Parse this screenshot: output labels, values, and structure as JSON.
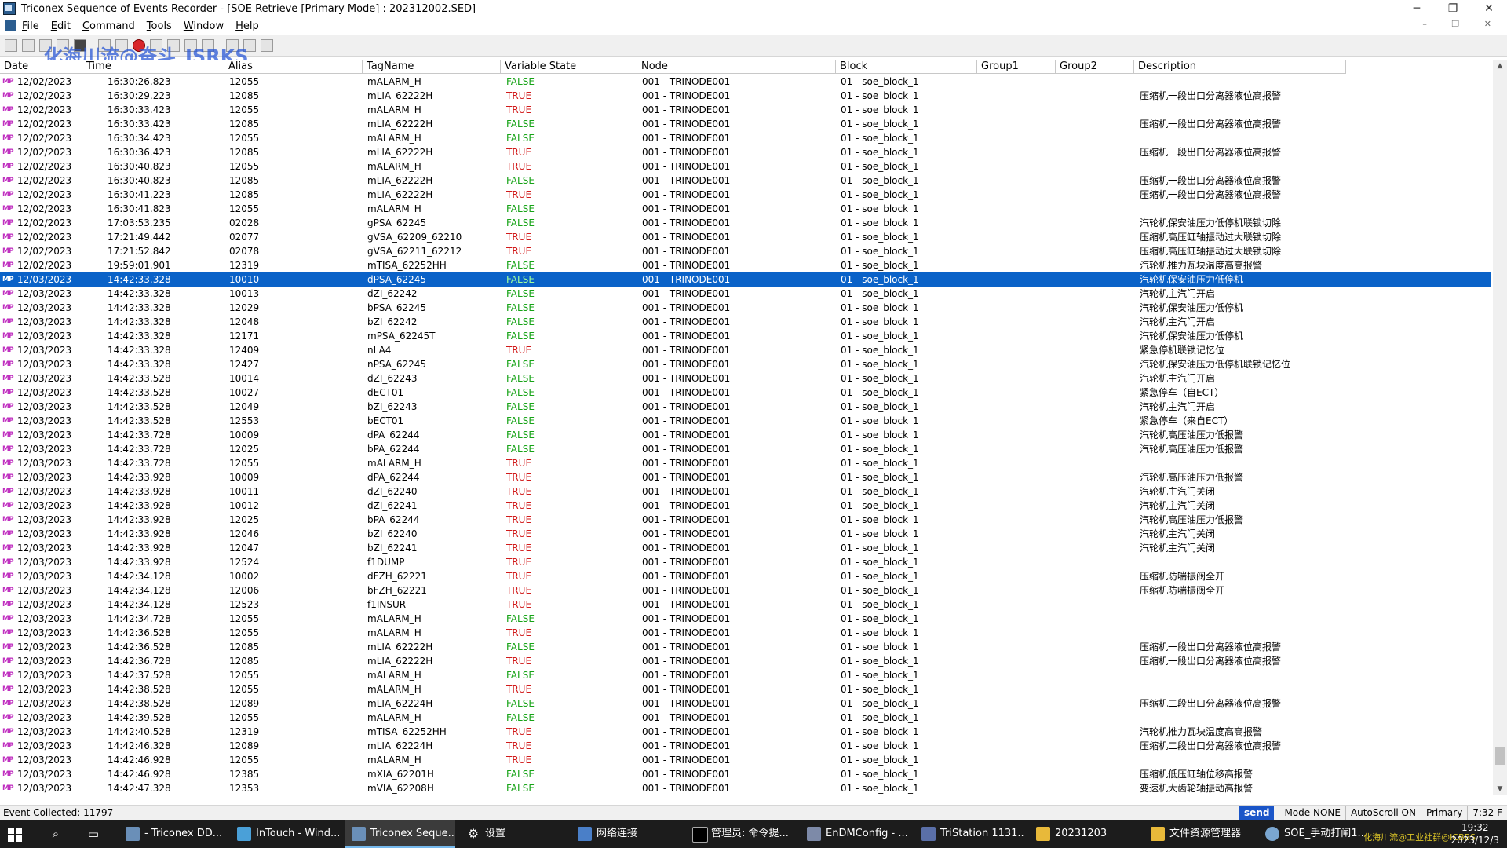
{
  "window": {
    "title": "Triconex Sequence of Events Recorder - [SOE Retrieve [Primary Mode] : 202312002.SED]",
    "min": "─",
    "max": "❐",
    "close": "✕"
  },
  "menu": [
    "File",
    "Edit",
    "Command",
    "Tools",
    "Window",
    "Help"
  ],
  "menu_mdi": "– ❐ ✕",
  "watermark": "化海川流@奋斗_ISRKS",
  "columns": [
    "Date",
    "Time",
    "Alias",
    "TagName",
    "Variable State",
    "Node",
    "Block",
    "Group1",
    "Group2",
    "Description"
  ],
  "rows": [
    {
      "mp": "MP",
      "date": "12/02/2023",
      "time": "16:30:26.823",
      "alias": "12055",
      "tag": "mALARM_H",
      "state": "FALSE",
      "node": "001 - TRINODE001",
      "block": "01 - soe_block_1",
      "desc": ""
    },
    {
      "mp": "MP",
      "date": "12/02/2023",
      "time": "16:30:29.223",
      "alias": "12085",
      "tag": "mLIA_62222H",
      "state": "TRUE",
      "node": "001 - TRINODE001",
      "block": "01 - soe_block_1",
      "desc": "压缩机一段出口分离器液位高报警"
    },
    {
      "mp": "MP",
      "date": "12/02/2023",
      "time": "16:30:33.423",
      "alias": "12055",
      "tag": "mALARM_H",
      "state": "TRUE",
      "node": "001 - TRINODE001",
      "block": "01 - soe_block_1",
      "desc": ""
    },
    {
      "mp": "MP",
      "date": "12/02/2023",
      "time": "16:30:33.423",
      "alias": "12085",
      "tag": "mLIA_62222H",
      "state": "FALSE",
      "node": "001 - TRINODE001",
      "block": "01 - soe_block_1",
      "desc": "压缩机一段出口分离器液位高报警"
    },
    {
      "mp": "MP",
      "date": "12/02/2023",
      "time": "16:30:34.423",
      "alias": "12055",
      "tag": "mALARM_H",
      "state": "FALSE",
      "node": "001 - TRINODE001",
      "block": "01 - soe_block_1",
      "desc": ""
    },
    {
      "mp": "MP",
      "date": "12/02/2023",
      "time": "16:30:36.423",
      "alias": "12085",
      "tag": "mLIA_62222H",
      "state": "TRUE",
      "node": "001 - TRINODE001",
      "block": "01 - soe_block_1",
      "desc": "压缩机一段出口分离器液位高报警"
    },
    {
      "mp": "MP",
      "date": "12/02/2023",
      "time": "16:30:40.823",
      "alias": "12055",
      "tag": "mALARM_H",
      "state": "TRUE",
      "node": "001 - TRINODE001",
      "block": "01 - soe_block_1",
      "desc": ""
    },
    {
      "mp": "MP",
      "date": "12/02/2023",
      "time": "16:30:40.823",
      "alias": "12085",
      "tag": "mLIA_62222H",
      "state": "FALSE",
      "node": "001 - TRINODE001",
      "block": "01 - soe_block_1",
      "desc": "压缩机一段出口分离器液位高报警"
    },
    {
      "mp": "MP",
      "date": "12/02/2023",
      "time": "16:30:41.223",
      "alias": "12085",
      "tag": "mLIA_62222H",
      "state": "TRUE",
      "node": "001 - TRINODE001",
      "block": "01 - soe_block_1",
      "desc": "压缩机一段出口分离器液位高报警"
    },
    {
      "mp": "MP",
      "date": "12/02/2023",
      "time": "16:30:41.823",
      "alias": "12055",
      "tag": "mALARM_H",
      "state": "FALSE",
      "node": "001 - TRINODE001",
      "block": "01 - soe_block_1",
      "desc": ""
    },
    {
      "mp": "MP",
      "date": "12/02/2023",
      "time": "17:03:53.235",
      "alias": "02028",
      "tag": "gPSA_62245",
      "state": "FALSE",
      "node": "001 - TRINODE001",
      "block": "01 - soe_block_1",
      "desc": "汽轮机保安油压力低停机联锁切除"
    },
    {
      "mp": "MP",
      "date": "12/02/2023",
      "time": "17:21:49.442",
      "alias": "02077",
      "tag": "gVSA_62209_62210",
      "state": "TRUE",
      "node": "001 - TRINODE001",
      "block": "01 - soe_block_1",
      "desc": "压缩机高压缸轴振动过大联锁切除"
    },
    {
      "mp": "MP",
      "date": "12/02/2023",
      "time": "17:21:52.842",
      "alias": "02078",
      "tag": "gVSA_62211_62212",
      "state": "TRUE",
      "node": "001 - TRINODE001",
      "block": "01 - soe_block_1",
      "desc": "压缩机高压缸轴振动过大联锁切除"
    },
    {
      "mp": "MP",
      "date": "12/02/2023",
      "time": "19:59:01.901",
      "alias": "12319",
      "tag": "mTISA_62252HH",
      "state": "FALSE",
      "node": "001 - TRINODE001",
      "block": "01 - soe_block_1",
      "desc": "汽轮机推力瓦块温度高高报警"
    },
    {
      "mp": "MP",
      "date": "12/03/2023",
      "time": "14:42:33.328",
      "alias": "10010",
      "tag": "dPSA_62245",
      "state": "FALSE",
      "node": "001 - TRINODE001",
      "block": "01 - soe_block_1",
      "desc": "汽轮机保安油压力低停机",
      "selected": true
    },
    {
      "mp": "MP",
      "date": "12/03/2023",
      "time": "14:42:33.328",
      "alias": "10013",
      "tag": "dZI_62242",
      "state": "FALSE",
      "node": "001 - TRINODE001",
      "block": "01 - soe_block_1",
      "desc": "汽轮机主汽门开启"
    },
    {
      "mp": "MP",
      "date": "12/03/2023",
      "time": "14:42:33.328",
      "alias": "12029",
      "tag": "bPSA_62245",
      "state": "FALSE",
      "node": "001 - TRINODE001",
      "block": "01 - soe_block_1",
      "desc": "汽轮机保安油压力低停机"
    },
    {
      "mp": "MP",
      "date": "12/03/2023",
      "time": "14:42:33.328",
      "alias": "12048",
      "tag": "bZI_62242",
      "state": "FALSE",
      "node": "001 - TRINODE001",
      "block": "01 - soe_block_1",
      "desc": "汽轮机主汽门开启"
    },
    {
      "mp": "MP",
      "date": "12/03/2023",
      "time": "14:42:33.328",
      "alias": "12171",
      "tag": "mPSA_62245T",
      "state": "FALSE",
      "node": "001 - TRINODE001",
      "block": "01 - soe_block_1",
      "desc": "汽轮机保安油压力低停机"
    },
    {
      "mp": "MP",
      "date": "12/03/2023",
      "time": "14:42:33.328",
      "alias": "12409",
      "tag": "nLA4",
      "state": "TRUE",
      "node": "001 - TRINODE001",
      "block": "01 - soe_block_1",
      "desc": "紧急停机联锁记忆位"
    },
    {
      "mp": "MP",
      "date": "12/03/2023",
      "time": "14:42:33.328",
      "alias": "12427",
      "tag": "nPSA_62245",
      "state": "FALSE",
      "node": "001 - TRINODE001",
      "block": "01 - soe_block_1",
      "desc": "汽轮机保安油压力低停机联锁记忆位"
    },
    {
      "mp": "MP",
      "date": "12/03/2023",
      "time": "14:42:33.528",
      "alias": "10014",
      "tag": "dZI_62243",
      "state": "FALSE",
      "node": "001 - TRINODE001",
      "block": "01 - soe_block_1",
      "desc": "汽轮机主汽门开启"
    },
    {
      "mp": "MP",
      "date": "12/03/2023",
      "time": "14:42:33.528",
      "alias": "10027",
      "tag": "dECT01",
      "state": "FALSE",
      "node": "001 - TRINODE001",
      "block": "01 - soe_block_1",
      "desc": "紧急停车（自ECT）"
    },
    {
      "mp": "MP",
      "date": "12/03/2023",
      "time": "14:42:33.528",
      "alias": "12049",
      "tag": "bZI_62243",
      "state": "FALSE",
      "node": "001 - TRINODE001",
      "block": "01 - soe_block_1",
      "desc": "汽轮机主汽门开启"
    },
    {
      "mp": "MP",
      "date": "12/03/2023",
      "time": "14:42:33.528",
      "alias": "12553",
      "tag": "bECT01",
      "state": "FALSE",
      "node": "001 - TRINODE001",
      "block": "01 - soe_block_1",
      "desc": "紧急停车（来自ECT）"
    },
    {
      "mp": "MP",
      "date": "12/03/2023",
      "time": "14:42:33.728",
      "alias": "10009",
      "tag": "dPA_62244",
      "state": "FALSE",
      "node": "001 - TRINODE001",
      "block": "01 - soe_block_1",
      "desc": "汽轮机高压油压力低报警"
    },
    {
      "mp": "MP",
      "date": "12/03/2023",
      "time": "14:42:33.728",
      "alias": "12025",
      "tag": "bPA_62244",
      "state": "FALSE",
      "node": "001 - TRINODE001",
      "block": "01 - soe_block_1",
      "desc": "汽轮机高压油压力低报警"
    },
    {
      "mp": "MP",
      "date": "12/03/2023",
      "time": "14:42:33.728",
      "alias": "12055",
      "tag": "mALARM_H",
      "state": "TRUE",
      "node": "001 - TRINODE001",
      "block": "01 - soe_block_1",
      "desc": ""
    },
    {
      "mp": "MP",
      "date": "12/03/2023",
      "time": "14:42:33.928",
      "alias": "10009",
      "tag": "dPA_62244",
      "state": "TRUE",
      "node": "001 - TRINODE001",
      "block": "01 - soe_block_1",
      "desc": "汽轮机高压油压力低报警"
    },
    {
      "mp": "MP",
      "date": "12/03/2023",
      "time": "14:42:33.928",
      "alias": "10011",
      "tag": "dZI_62240",
      "state": "TRUE",
      "node": "001 - TRINODE001",
      "block": "01 - soe_block_1",
      "desc": "汽轮机主汽门关闭"
    },
    {
      "mp": "MP",
      "date": "12/03/2023",
      "time": "14:42:33.928",
      "alias": "10012",
      "tag": "dZI_62241",
      "state": "TRUE",
      "node": "001 - TRINODE001",
      "block": "01 - soe_block_1",
      "desc": "汽轮机主汽门关闭"
    },
    {
      "mp": "MP",
      "date": "12/03/2023",
      "time": "14:42:33.928",
      "alias": "12025",
      "tag": "bPA_62244",
      "state": "TRUE",
      "node": "001 - TRINODE001",
      "block": "01 - soe_block_1",
      "desc": "汽轮机高压油压力低报警"
    },
    {
      "mp": "MP",
      "date": "12/03/2023",
      "time": "14:42:33.928",
      "alias": "12046",
      "tag": "bZI_62240",
      "state": "TRUE",
      "node": "001 - TRINODE001",
      "block": "01 - soe_block_1",
      "desc": "汽轮机主汽门关闭"
    },
    {
      "mp": "MP",
      "date": "12/03/2023",
      "time": "14:42:33.928",
      "alias": "12047",
      "tag": "bZI_62241",
      "state": "TRUE",
      "node": "001 - TRINODE001",
      "block": "01 - soe_block_1",
      "desc": "汽轮机主汽门关闭"
    },
    {
      "mp": "MP",
      "date": "12/03/2023",
      "time": "14:42:33.928",
      "alias": "12524",
      "tag": "f1DUMP",
      "state": "TRUE",
      "node": "001 - TRINODE001",
      "block": "01 - soe_block_1",
      "desc": ""
    },
    {
      "mp": "MP",
      "date": "12/03/2023",
      "time": "14:42:34.128",
      "alias": "10002",
      "tag": "dFZH_62221",
      "state": "TRUE",
      "node": "001 - TRINODE001",
      "block": "01 - soe_block_1",
      "desc": "压缩机防喘振阀全开"
    },
    {
      "mp": "MP",
      "date": "12/03/2023",
      "time": "14:42:34.128",
      "alias": "12006",
      "tag": "bFZH_62221",
      "state": "TRUE",
      "node": "001 - TRINODE001",
      "block": "01 - soe_block_1",
      "desc": "压缩机防喘振阀全开"
    },
    {
      "mp": "MP",
      "date": "12/03/2023",
      "time": "14:42:34.128",
      "alias": "12523",
      "tag": "f1INSUR",
      "state": "TRUE",
      "node": "001 - TRINODE001",
      "block": "01 - soe_block_1",
      "desc": ""
    },
    {
      "mp": "MP",
      "date": "12/03/2023",
      "time": "14:42:34.728",
      "alias": "12055",
      "tag": "mALARM_H",
      "state": "FALSE",
      "node": "001 - TRINODE001",
      "block": "01 - soe_block_1",
      "desc": ""
    },
    {
      "mp": "MP",
      "date": "12/03/2023",
      "time": "14:42:36.528",
      "alias": "12055",
      "tag": "mALARM_H",
      "state": "TRUE",
      "node": "001 - TRINODE001",
      "block": "01 - soe_block_1",
      "desc": ""
    },
    {
      "mp": "MP",
      "date": "12/03/2023",
      "time": "14:42:36.528",
      "alias": "12085",
      "tag": "mLIA_62222H",
      "state": "FALSE",
      "node": "001 - TRINODE001",
      "block": "01 - soe_block_1",
      "desc": "压缩机一段出口分离器液位高报警"
    },
    {
      "mp": "MP",
      "date": "12/03/2023",
      "time": "14:42:36.728",
      "alias": "12085",
      "tag": "mLIA_62222H",
      "state": "TRUE",
      "node": "001 - TRINODE001",
      "block": "01 - soe_block_1",
      "desc": "压缩机一段出口分离器液位高报警"
    },
    {
      "mp": "MP",
      "date": "12/03/2023",
      "time": "14:42:37.528",
      "alias": "12055",
      "tag": "mALARM_H",
      "state": "FALSE",
      "node": "001 - TRINODE001",
      "block": "01 - soe_block_1",
      "desc": ""
    },
    {
      "mp": "MP",
      "date": "12/03/2023",
      "time": "14:42:38.528",
      "alias": "12055",
      "tag": "mALARM_H",
      "state": "TRUE",
      "node": "001 - TRINODE001",
      "block": "01 - soe_block_1",
      "desc": ""
    },
    {
      "mp": "MP",
      "date": "12/03/2023",
      "time": "14:42:38.528",
      "alias": "12089",
      "tag": "mLIA_62224H",
      "state": "FALSE",
      "node": "001 - TRINODE001",
      "block": "01 - soe_block_1",
      "desc": "压缩机二段出口分离器液位高报警"
    },
    {
      "mp": "MP",
      "date": "12/03/2023",
      "time": "14:42:39.528",
      "alias": "12055",
      "tag": "mALARM_H",
      "state": "FALSE",
      "node": "001 - TRINODE001",
      "block": "01 - soe_block_1",
      "desc": ""
    },
    {
      "mp": "MP",
      "date": "12/03/2023",
      "time": "14:42:40.528",
      "alias": "12319",
      "tag": "mTISA_62252HH",
      "state": "TRUE",
      "node": "001 - TRINODE001",
      "block": "01 - soe_block_1",
      "desc": "汽轮机推力瓦块温度高高报警"
    },
    {
      "mp": "MP",
      "date": "12/03/2023",
      "time": "14:42:46.328",
      "alias": "12089",
      "tag": "mLIA_62224H",
      "state": "TRUE",
      "node": "001 - TRINODE001",
      "block": "01 - soe_block_1",
      "desc": "压缩机二段出口分离器液位高报警"
    },
    {
      "mp": "MP",
      "date": "12/03/2023",
      "time": "14:42:46.928",
      "alias": "12055",
      "tag": "mALARM_H",
      "state": "TRUE",
      "node": "001 - TRINODE001",
      "block": "01 - soe_block_1",
      "desc": ""
    },
    {
      "mp": "MP",
      "date": "12/03/2023",
      "time": "14:42:46.928",
      "alias": "12385",
      "tag": "mXIA_62201H",
      "state": "FALSE",
      "node": "001 - TRINODE001",
      "block": "01 - soe_block_1",
      "desc": "压缩机低压缸轴位移高报警"
    },
    {
      "mp": "MP",
      "date": "12/03/2023",
      "time": "14:42:47.328",
      "alias": "12353",
      "tag": "mVIA_62208H",
      "state": "FALSE",
      "node": "001 - TRINODE001",
      "block": "01 - soe_block_1",
      "desc": "变速机大齿轮轴振动高报警"
    }
  ],
  "colors": {
    "true_state": "#d11a1a",
    "false_state": "#16a316",
    "selected_row": "#0a62c8",
    "send_badge": "#1a55c8"
  },
  "status": {
    "events": "Event Collected: 11797",
    "send": "send",
    "mode": "Mode NONE",
    "autoscroll": "AutoScroll ON",
    "primary": "Primary",
    "time": "7:32 F"
  },
  "taskbar": {
    "tasks": [
      "- Triconex DD...",
      "InTouch - Wind...",
      "Triconex Seque...",
      "设置",
      "网络连接",
      "管理员: 命令提...",
      "EnDMConfig - ...",
      "TriStation 1131...",
      "20231203",
      "文件资源管理器",
      "SOE_手动打闸1..."
    ],
    "clock_time": "19:32",
    "clock_date": "2023/12/3",
    "tray_watermark": "化海川流@工业社群@ICBBS"
  }
}
